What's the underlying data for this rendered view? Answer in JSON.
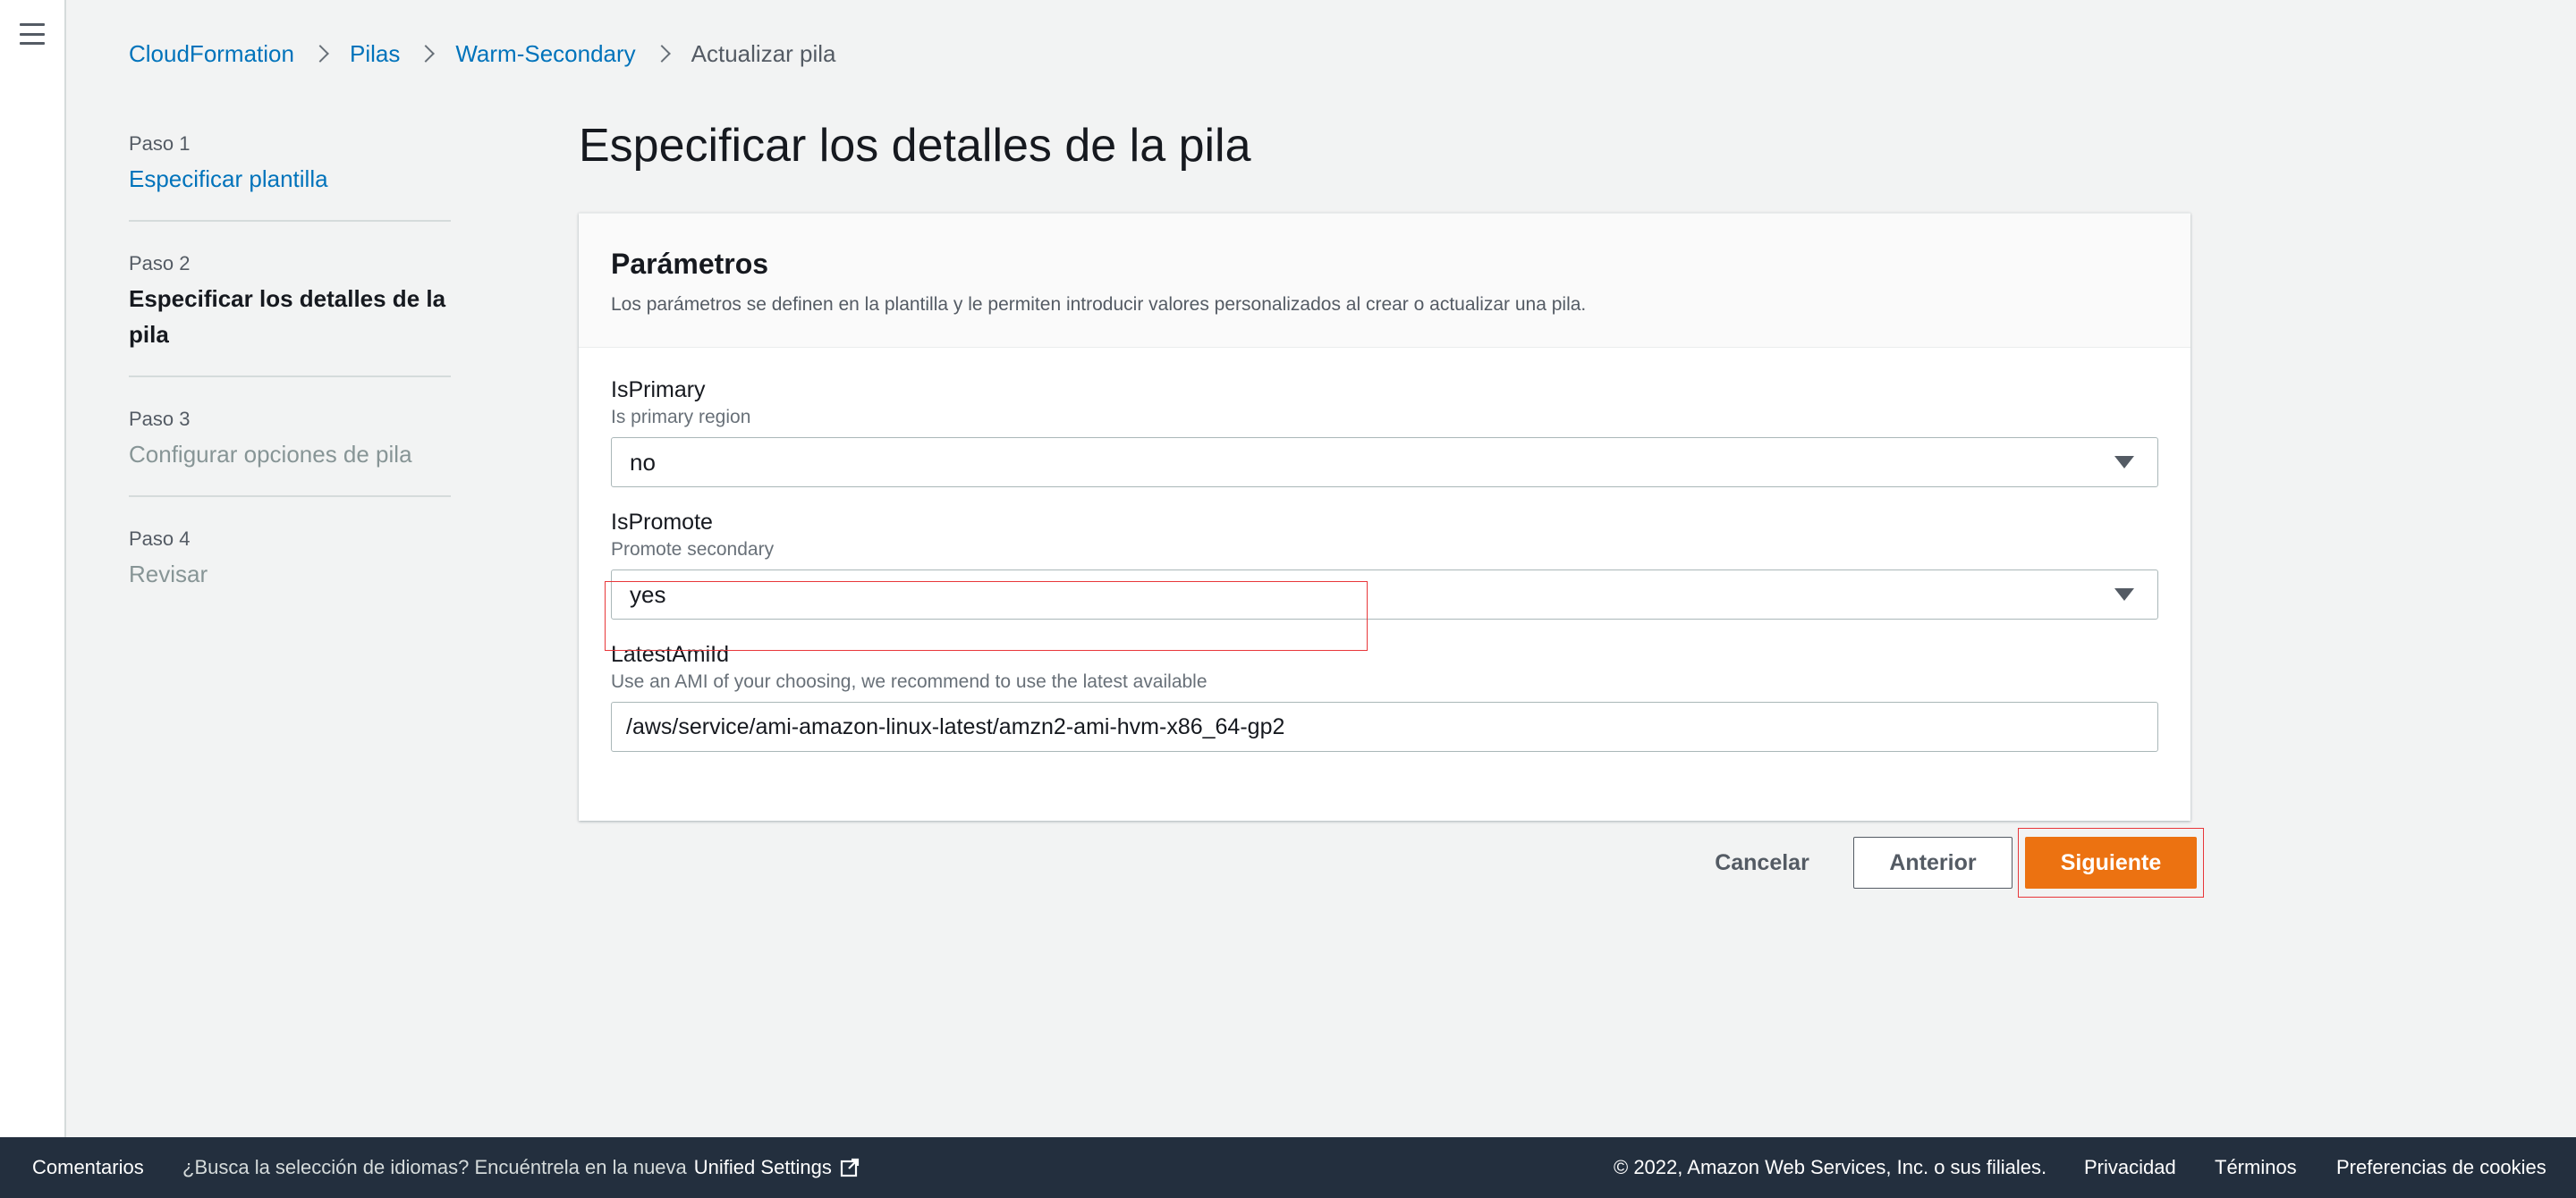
{
  "nav": {
    "menu_icon": "hamburger-menu-icon"
  },
  "breadcrumb": {
    "items": [
      "CloudFormation",
      "Pilas",
      "Warm-Secondary"
    ],
    "current": "Actualizar pila"
  },
  "steps": [
    {
      "num": "Paso 1",
      "title": "Especificar plantilla",
      "state": "link"
    },
    {
      "num": "Paso 2",
      "title": "Especificar los detalles de la pila",
      "state": "active"
    },
    {
      "num": "Paso 3",
      "title": "Configurar opciones de pila",
      "state": "disabled"
    },
    {
      "num": "Paso 4",
      "title": "Revisar",
      "state": "disabled"
    }
  ],
  "main": {
    "title": "Especificar los detalles de la pila",
    "panel": {
      "title": "Parámetros",
      "description": "Los parámetros se definen en la plantilla y le permiten introducir valores personalizados al crear o actualizar una pila.",
      "fields": [
        {
          "label": "IsPrimary",
          "description": "Is primary region",
          "type": "select",
          "value": "no"
        },
        {
          "label": "IsPromote",
          "description": "Promote secondary",
          "type": "select",
          "value": "yes"
        },
        {
          "label": "LatestAmiId",
          "description": "Use an AMI of your choosing, we recommend to use the latest available",
          "type": "text",
          "value": "/aws/service/ami-amazon-linux-latest/amzn2-ami-hvm-x86_64-gp2"
        }
      ]
    },
    "buttons": {
      "cancel": "Cancelar",
      "previous": "Anterior",
      "next": "Siguiente"
    }
  },
  "footer": {
    "comments": "Comentarios",
    "language_prompt": "¿Busca la selección de idiomas? Encuéntrela en la nueva",
    "unified_settings": "Unified Settings",
    "copyright": "© 2022, Amazon Web Services, Inc. o sus filiales.",
    "privacy": "Privacidad",
    "terms": "Términos",
    "cookies": "Preferencias de cookies"
  },
  "colors": {
    "link": "#0073bb",
    "primary_button": "#ec7211",
    "footer_bg": "#232f3e",
    "highlight": "#e8373a"
  }
}
